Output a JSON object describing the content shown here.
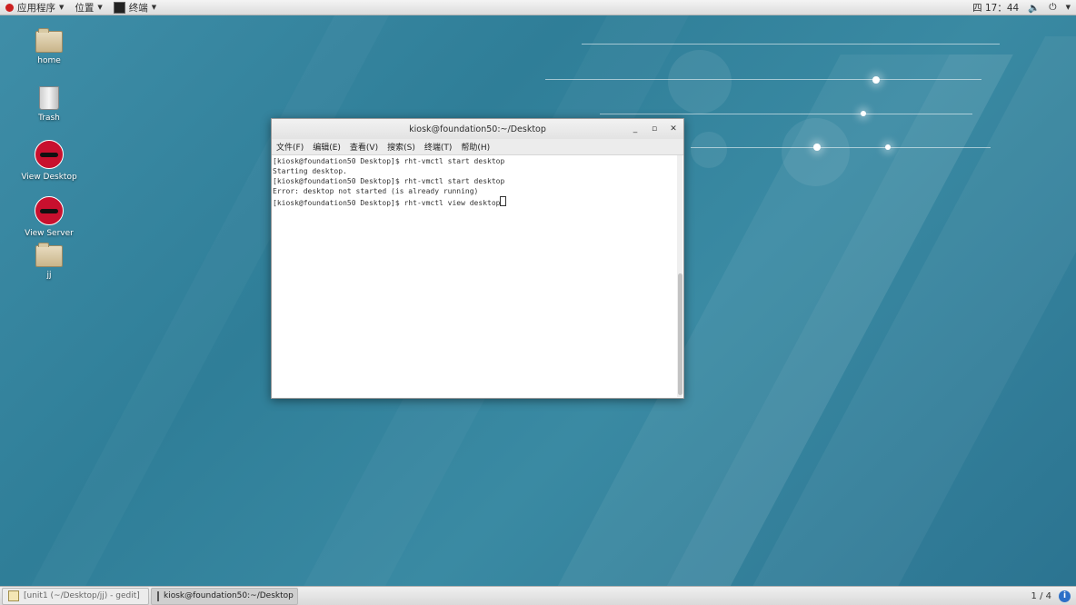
{
  "top_panel": {
    "applications_label": "应用程序",
    "places_label": "位置",
    "terminal_label": "终端",
    "clock": "四 17：44"
  },
  "desktop_icons": [
    {
      "label": "home"
    },
    {
      "label": "Trash"
    },
    {
      "label": "View Desktop"
    },
    {
      "label": "View Server"
    },
    {
      "label": "jj"
    }
  ],
  "terminal": {
    "title": "kiosk@foundation50:~/Desktop",
    "menu": [
      "文件(F)",
      "编辑(E)",
      "查看(V)",
      "搜索(S)",
      "终端(T)",
      "帮助(H)"
    ],
    "lines": [
      "[kiosk@foundation50 Desktop]$ rht-vmctl start desktop",
      "Starting desktop.",
      "[kiosk@foundation50 Desktop]$ rht-vmctl start desktop",
      "Error: desktop not started (is already running)",
      "[kiosk@foundation50 Desktop]$ rht-vmctl view desktop"
    ]
  },
  "taskbar": {
    "tasks": [
      {
        "label": "[unit1 (~/Desktop/jj) - gedit]",
        "active": false
      },
      {
        "label": "kiosk@foundation50:~/Desktop",
        "active": true
      }
    ],
    "workspace": "1 / 4"
  },
  "colors": {
    "desktop_bg": "#3a8aa3",
    "panel_bg": "#e4e4e4"
  }
}
